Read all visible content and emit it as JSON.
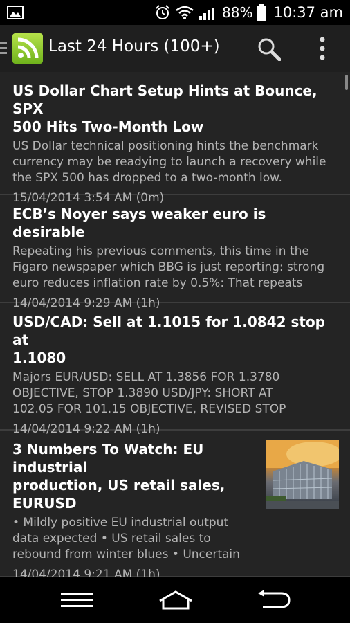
{
  "status": {
    "battery": "88%",
    "time": "10:37 am"
  },
  "appbar": {
    "title": "Last 24 Hours (100+)"
  },
  "feed": [
    {
      "title_lines": [
        "US Dollar Chart Setup Hints at Bounce, SPX",
        "500 Hits Two-Month Low"
      ],
      "desc_lines": [
        "US Dollar technical positioning hints the benchmark",
        "currency may be readying to launch a recovery while",
        "the SPX 500 has dropped to a two-month low."
      ],
      "date": "15/04/2014 3:54 AM (0m)"
    },
    {
      "title_lines": [
        "ECB’s Noyer says weaker euro is desirable"
      ],
      "desc_lines": [
        "Repeating his previous comments, this time in the",
        "Figaro newspaper which BBG is just reporting: strong",
        "euro reduces inflation rate by 0.5%: That repeats"
      ],
      "date": "14/04/2014 9:29 AM (1h)"
    },
    {
      "title_lines": [
        "USD/CAD: Sell at 1.1015 for 1.0842 stop at",
        "1.1080"
      ],
      "desc_lines": [
        "Majors EUR/USD: SELL AT 1.3856 FOR 1.3780",
        "OBJECTIVE, STOP 1.3890 USD/JPY: SHORT AT",
        "102.05 FOR 101.15 OBJECTIVE, REVISED STOP"
      ],
      "date": "14/04/2014 9:22 AM (1h)"
    },
    {
      "title_lines": [
        "3 Numbers To Watch: EU industrial",
        "production, US retail sales,",
        "EURUSD"
      ],
      "desc_lines": [
        "• Mildly positive EU industrial output",
        "data expected • US retail sales to",
        "rebound from winter blues • Uncertain"
      ],
      "date": "14/04/2014 9:21 AM (1h)"
    }
  ]
}
